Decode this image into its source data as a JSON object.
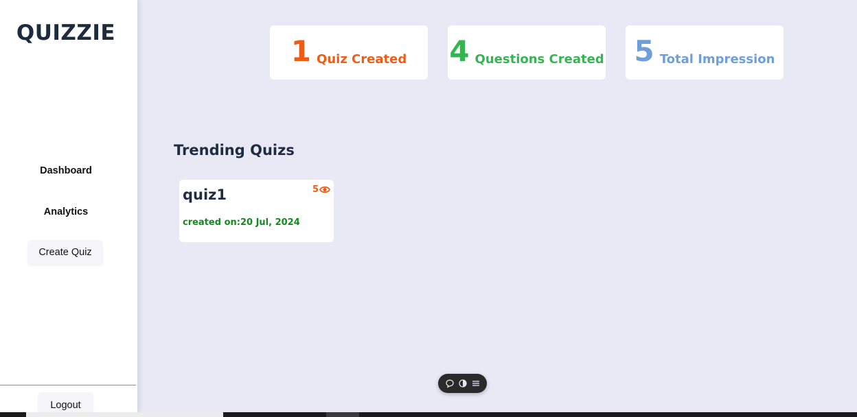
{
  "app": {
    "logo": "QUIZZIE"
  },
  "sidebar": {
    "items": [
      {
        "label": "Dashboard"
      },
      {
        "label": "Analytics"
      },
      {
        "label": "Create Quiz"
      }
    ],
    "logout_label": "Logout"
  },
  "stats": [
    {
      "value": "1",
      "label": "Quiz Created",
      "color": "#ee5c16"
    },
    {
      "value": "4",
      "label": "Questions Created",
      "color": "#35b552"
    },
    {
      "value": "5",
      "label": "Total Impression",
      "color": "#6d9fdb"
    }
  ],
  "trending": {
    "title": "Trending Quizs",
    "quizzes": [
      {
        "name": "quiz1",
        "impressions": "5",
        "created": "created on:20 Jul, 2024"
      }
    ]
  },
  "toolbar": {
    "icons": [
      "chat-bubble-icon",
      "toggle-icon",
      "settings-sliders-icon"
    ]
  },
  "colors": {
    "background": "#e9e9f5",
    "sidebar": "#ffffff",
    "heading": "#1f2d40",
    "date_green": "#138a1d"
  }
}
